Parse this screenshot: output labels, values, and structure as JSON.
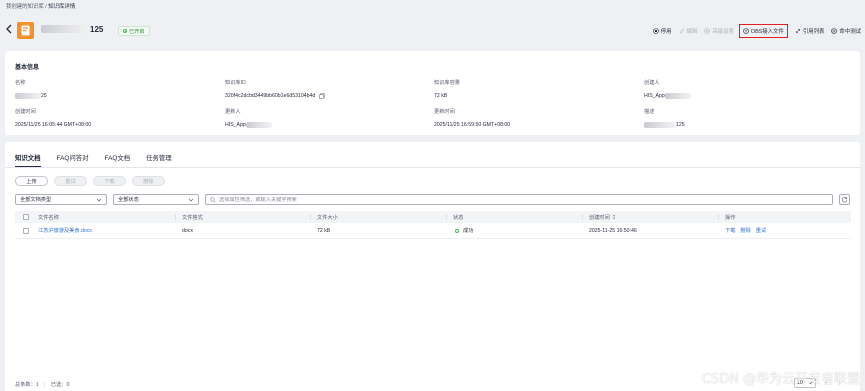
{
  "breadcrumb": {
    "parent": "我创建的知识库",
    "sep": " / ",
    "current": "知识库详情"
  },
  "header": {
    "name_suffix": "125",
    "status": "已开启"
  },
  "actions": [
    {
      "label": "停用",
      "icon": "stop-circle-icon",
      "disabled": false
    },
    {
      "label": "编辑",
      "icon": "edit-icon",
      "disabled": true
    },
    {
      "label": "高级设置",
      "icon": "settings-icon",
      "disabled": true
    },
    {
      "label": "OBS接入文件",
      "icon": "upload-circle-icon",
      "disabled": false,
      "highlight": true
    },
    {
      "label": "引用列表",
      "icon": "link-icon",
      "disabled": false
    },
    {
      "label": "命中测试",
      "icon": "target-icon",
      "disabled": false
    }
  ],
  "info": {
    "title": "基本信息",
    "fields": {
      "name": {
        "label": "名称",
        "value": "25"
      },
      "kb_id": {
        "label": "知识库ID",
        "value": "320f4c2dcbd3449bb60b1e6d53104b4d"
      },
      "capacity": {
        "label": "知识库容量",
        "value": "72 kB"
      },
      "creator": {
        "label": "创建人",
        "value": "HIS_App"
      },
      "created": {
        "label": "创建时间",
        "value": "2025/11/25 16:05:44 GMT+08:00"
      },
      "updater": {
        "label": "更新人",
        "value": "HIS_App"
      },
      "updated": {
        "label": "更新时间",
        "value": "2025/11/25 16:59:50 GMT+08:00"
      },
      "desc": {
        "label": "描述",
        "value": "125"
      }
    }
  },
  "tabs": [
    "知识文档",
    "FAQ问答对",
    "FAQ文档",
    "任务管理"
  ],
  "buttons": {
    "upload": "上传",
    "retry": "重试",
    "download": "下载",
    "delete": "删除"
  },
  "filters": {
    "doc_type": "全部文档类型",
    "status": "全部状态",
    "search_placeholder": "选择属性筛选，或输入关键字搜索"
  },
  "table": {
    "headers": {
      "name": "文件名称",
      "format": "文件格式",
      "size": "文件大小",
      "status": "状态",
      "created": "创建时间",
      "ops": "操作"
    },
    "rows": [
      {
        "name": "江苏沪旅游及美食.docx",
        "format": "docx",
        "size": "72 kB",
        "status": "成功",
        "created": "2025-11-25 16:50:46",
        "ops": [
          "下载",
          "删除",
          "重试"
        ]
      }
    ]
  },
  "footer": {
    "total": "总条数：1",
    "selected": "已选：0",
    "page_size": "10"
  },
  "watermark": "CSDN @华为云开发者联盟",
  "colors": {
    "accent": "#2e6fd6",
    "kb_icon": "#f5902b",
    "success": "#50b15a",
    "highlight_border": "#e02020"
  }
}
